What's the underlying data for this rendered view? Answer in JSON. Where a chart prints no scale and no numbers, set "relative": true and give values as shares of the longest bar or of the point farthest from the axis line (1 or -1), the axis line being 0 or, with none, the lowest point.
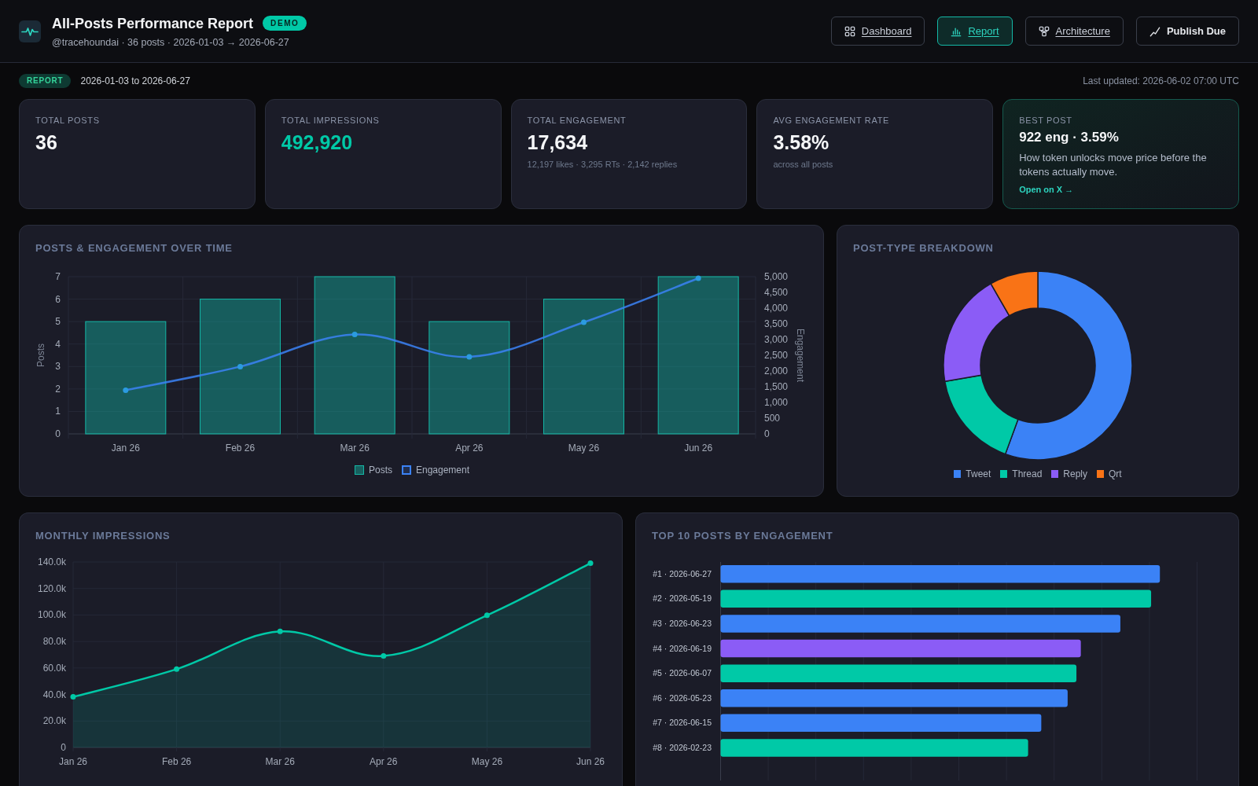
{
  "header": {
    "title": "All-Posts Performance Report",
    "badge": "DEMO",
    "subtitle": "@tracehoundai · 36 posts · 2026-01-03 → 2026-06-27",
    "nav": [
      {
        "label": "Dashboard",
        "kind": "link",
        "selected": false
      },
      {
        "label": "Report",
        "kind": "link",
        "selected": true
      },
      {
        "label": "Architecture",
        "kind": "link",
        "selected": false
      },
      {
        "label": "Publish Due",
        "kind": "button",
        "selected": false
      }
    ]
  },
  "report_bar": {
    "badge": "REPORT",
    "range": "2026-01-03 to 2026-06-27",
    "last_updated": "Last updated: 2026-06-02 07:00 UTC"
  },
  "kpis": [
    {
      "kind": "stat",
      "label": "TOTAL POSTS",
      "value": "36",
      "accent": false
    },
    {
      "kind": "stat",
      "label": "TOTAL IMPRESSIONS",
      "value": "492,920",
      "accent": true
    },
    {
      "kind": "stat",
      "label": "TOTAL ENGAGEMENT",
      "value": "17,634",
      "accent": false,
      "detail": "12,197 likes · 3,295 RTs · 2,142 replies"
    },
    {
      "kind": "stat",
      "label": "AVG ENGAGEMENT RATE",
      "value": "3.58%",
      "accent": false,
      "detail": "across all posts"
    },
    {
      "kind": "best_post",
      "label": "BEST POST",
      "value": "922 eng · 3.59%",
      "text": "How token unlocks move price before the tokens actually move.",
      "link": "Open on X →"
    }
  ],
  "posts_engagement": {
    "chart_data": {
      "type": "bar",
      "title": "POSTS & ENGAGEMENT OVER TIME",
      "ylabel": "Posts",
      "y2label": "Engagement",
      "grid": true,
      "legend": "bottom",
      "categories": [
        "Jan 26",
        "Feb 26",
        "Mar 26",
        "Apr 26",
        "May 26",
        "Jun 26"
      ],
      "ylim": [
        0,
        7
      ],
      "yticks": [
        0,
        1,
        2,
        3,
        4,
        5,
        6,
        7
      ],
      "y2lim": [
        0,
        5000
      ],
      "y2ticks": [
        {
          "value": 0,
          "label": "0"
        },
        {
          "value": 500,
          "label": "500"
        },
        {
          "value": 1000,
          "label": "1,000"
        },
        {
          "value": 1500,
          "label": "1,500"
        },
        {
          "value": 2000,
          "label": "2,000"
        },
        {
          "value": 2500,
          "label": "2,500"
        },
        {
          "value": 3000,
          "label": "3,000"
        },
        {
          "value": 3500,
          "label": "3,500"
        },
        {
          "value": 4000,
          "label": "4,000"
        },
        {
          "value": 4500,
          "label": "4,500"
        },
        {
          "value": 5000,
          "label": "5,000"
        }
      ],
      "series": [
        {
          "name": "Posts",
          "color": "#14b8a6",
          "type": "bar",
          "values": [
            5,
            6,
            7,
            5,
            6,
            7
          ]
        },
        {
          "name": "Engagement",
          "color": "#3b82f6",
          "type": "line",
          "axis": "y2",
          "marker": "circle",
          "values": [
            1390,
            2140,
            3160,
            2450,
            3550,
            4950
          ]
        }
      ]
    }
  },
  "post_types": {
    "chart_data": {
      "type": "donut",
      "title": "POST-TYPE BREAKDOWN",
      "legend": "bottom",
      "categories": [
        "Tweet",
        "Thread",
        "Reply",
        "Qrt"
      ],
      "colors": [
        "#3b82f6",
        "#00c9a7",
        "#8b5cf6",
        "#f97316"
      ],
      "series": [
        {
          "values": [
            55.6,
            16.7,
            19.4,
            8.3
          ]
        }
      ]
    }
  },
  "monthly_impressions": {
    "chart_data": {
      "type": "area",
      "title": "MONTHLY IMPRESSIONS",
      "grid": true,
      "categories": [
        "Jan 26",
        "Feb 26",
        "Mar 26",
        "Apr 26",
        "May 26",
        "Jun 26"
      ],
      "ylim": [
        0,
        140000
      ],
      "yticks": [
        {
          "value": 0,
          "label": "0"
        },
        {
          "value": 20000,
          "label": "20.0k"
        },
        {
          "value": 40000,
          "label": "40.0k"
        },
        {
          "value": 60000,
          "label": "60.0k"
        },
        {
          "value": 80000,
          "label": "80.0k"
        },
        {
          "value": 100000,
          "label": "100.0k"
        },
        {
          "value": 120000,
          "label": "120.0k"
        },
        {
          "value": 140000,
          "label": "140.0k"
        }
      ],
      "series": [
        {
          "color": "#00c9a7",
          "marker": "circle",
          "values": [
            38200,
            59100,
            87600,
            69100,
            99800,
            139100
          ]
        }
      ]
    }
  },
  "top_posts": {
    "chart_data": {
      "type": "bar",
      "orientation": "horizontal",
      "relative": true,
      "title": "TOP 10 POSTS BY ENGAGEMENT",
      "grid": true,
      "categories": [
        "#1 · 2026-06-27",
        "#2 · 2026-05-19",
        "#3 · 2026-06-23",
        "#4 · 2026-06-19",
        "#5 · 2026-06-07",
        "#6 · 2026-05-23",
        "#7 · 2026-06-15",
        "#8 · 2026-02-23"
      ],
      "colors": [
        "#3b82f6",
        "#00c9a7",
        "#3b82f6",
        "#8b5cf6",
        "#00c9a7",
        "#3b82f6",
        "#3b82f6",
        "#00c9a7"
      ],
      "series": [
        {
          "values": [
            1,
            0.98,
            0.91,
            0.82,
            0.81,
            0.79,
            0.73,
            0.7
          ]
        }
      ]
    }
  }
}
